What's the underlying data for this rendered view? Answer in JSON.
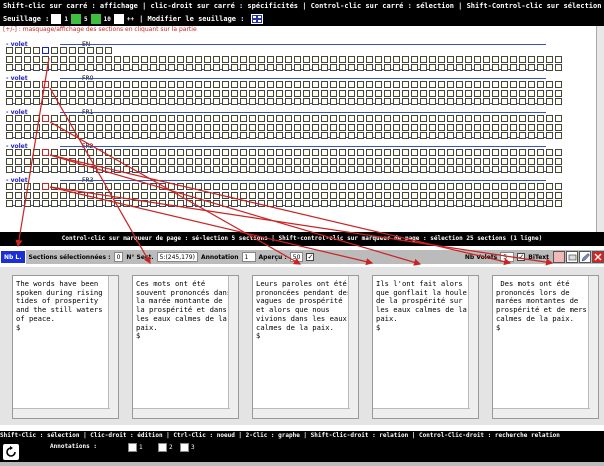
{
  "top_help": "Shift-clic sur carré : affichage | clic-droit sur carré : spécificités | Control-clic sur carré : sélection | Shift-Control-clic sur sélection : désélection",
  "tile_bar": {
    "label": "Seuillage :",
    "value1": "1",
    "value2": "5",
    "value3": "10",
    "plus": "++",
    "modify": "| Modifier le seuillage :"
  },
  "grid": {
    "title": "[+/-] : masquage/affichage des sections en cliquant sur la partie",
    "volumes": [
      {
        "label": "- volet",
        "name": "EN"
      },
      {
        "label": "- volet",
        "name": "FR0"
      },
      {
        "label": "- volet",
        "name": "FR1"
      },
      {
        "label": "- volet",
        "name": "FR2"
      },
      {
        "label": "- volet",
        "name": "FR3"
      }
    ]
  },
  "mid_help": "Control-clic sur marqueur de page : sé-lection 5 sections | Shift-control-clic sur marqueur de page : sélection 25 sections (1 ligne)",
  "toolbar": {
    "nbl": "Nb L.",
    "sections_label": "Sections sélectionnées :",
    "sections_value": "0",
    "sect_label": "N° Sect.",
    "sect_value": "5:(245,179)",
    "annotation_label": "Annotation",
    "annotation_value": "1",
    "apercu_label": "Aperçu :",
    "apercu_value": "50",
    "nbvolets_label": "Nb Volets",
    "nbvolets_value": "5",
    "bitext_label": "BiText",
    "check_mark": "✓"
  },
  "panels": [
    {
      "text": "The words have been spoken during rising tides of prosperity and the still waters of peace.\n$"
    },
    {
      "text": "Ces mots ont été souvent prononcés dans la marée montante de la prospérité et dans les eaux calmes de la paix.\n$"
    },
    {
      "text": "Leurs paroles ont été prononcées pendant des vagues de prospérité et alors que nous vivions dans les eaux calmes de la paix.\n$"
    },
    {
      "text": "Ils l'ont fait alors que gonflait la houle de la prospérité sur les eaux calmes de la paix.\n$"
    },
    {
      "text": " Des mots ont été prononcés lors de marées montantes de prospérité et de mers calmes de la paix.\n$"
    }
  ],
  "bottom_help": "Shift-Clic : sélection | Clic-droit : édition | Ctrl-Clic : noeud | 2-Clic : graphe | Shift-Clic-droit : relation | Control-Clic-droit : recherche relation",
  "annotations": {
    "label": "Annotations :",
    "options": [
      "1",
      "2",
      "3"
    ]
  },
  "colors": {
    "accent_blue": "#1a2fd6",
    "arrow_red": "#cc2222",
    "tile_green": "#3fbf3f"
  },
  "icons": [
    "tile-grid-icon",
    "refresh-icon",
    "eraser-icon",
    "pen-icon",
    "close-icon"
  ]
}
